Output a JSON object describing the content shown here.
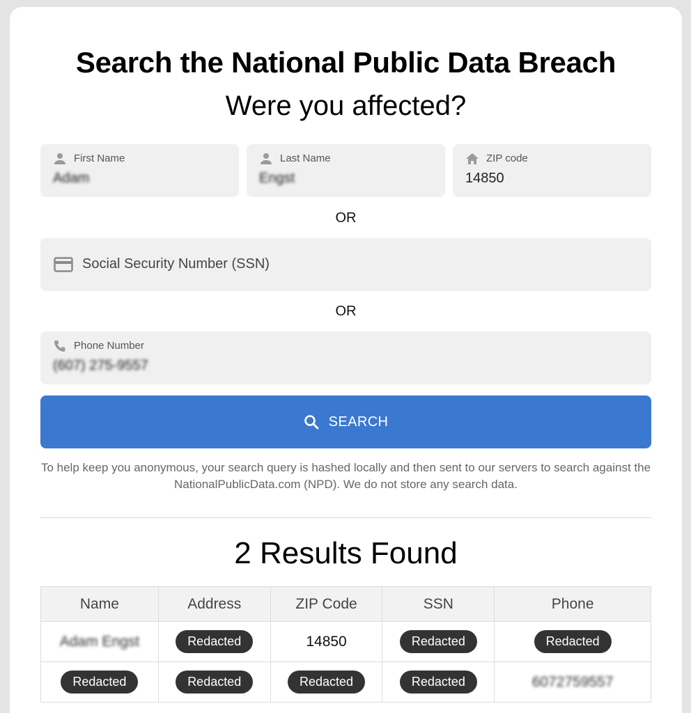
{
  "page": {
    "title": "Search the National Public Data Breach",
    "subtitle": "Were you affected?"
  },
  "form": {
    "first_name": {
      "label": "First Name",
      "value": "Adam",
      "icon": "person-icon"
    },
    "last_name": {
      "label": "Last Name",
      "value": "Engst",
      "icon": "person-icon"
    },
    "zip": {
      "label": "ZIP code",
      "value": "14850",
      "icon": "home-icon"
    },
    "or_1": "OR",
    "ssn": {
      "label": "Social Security Number (SSN)",
      "icon": "credit-card-icon"
    },
    "or_2": "OR",
    "phone": {
      "label": "Phone Number",
      "value": "(607) 275-9557",
      "icon": "phone-icon"
    },
    "search_button": "SEARCH"
  },
  "note": "To help keep you anonymous, your search query is hashed locally and then sent to our servers to search against the NationalPublicData.com (NPD). We do not store any search data.",
  "results": {
    "heading": "2 Results Found",
    "columns": [
      "Name",
      "Address",
      "ZIP Code",
      "SSN",
      "Phone"
    ],
    "rows": [
      [
        "Adam Engst",
        "Redacted",
        "14850",
        "Redacted",
        "Redacted"
      ],
      [
        "Redacted",
        "Redacted",
        "Redacted",
        "Redacted",
        "6072759557"
      ]
    ]
  },
  "colors": {
    "accent": "#3b78d0",
    "pill": "#333333",
    "field_bg": "#f0f0f0"
  }
}
